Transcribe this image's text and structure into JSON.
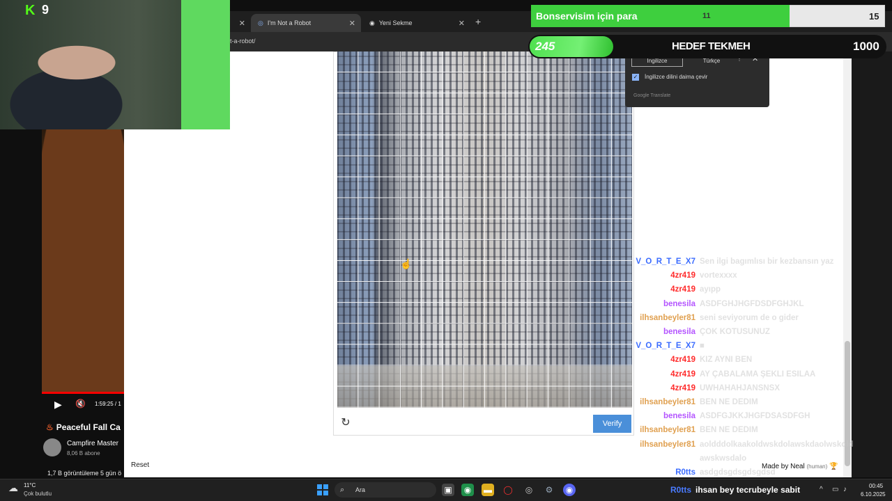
{
  "browser": {
    "tabs": [
      {
        "label": ""
      },
      {
        "label": "I'm Not a Robot"
      },
      {
        "label": "Yeni Sekme"
      }
    ],
    "new_tab": "+",
    "url": "t-a-robot/"
  },
  "translate": {
    "lang_from": "İngilizce",
    "lang_to": "Türkçe",
    "more": "⋮",
    "close": "✕",
    "always_label": "İngilizce dilini daima çevir",
    "brand": "Google Translate"
  },
  "captcha": {
    "verify_label": "Verify",
    "refresh": "↻"
  },
  "page": {
    "reset_label": "Reset"
  },
  "stream": {
    "kick_logo": "K",
    "kick_count": "9",
    "goal": {
      "label": "Bonservisim için para",
      "current": "11",
      "target": "15",
      "progress": 0.73
    },
    "hedef": {
      "count": "245",
      "label": "HEDEF TEKMEH",
      "target": "1000",
      "progress": 0.245
    },
    "made_by": "Made by Neal",
    "made_by_note": "(human)",
    "pinned_user": "R0tts",
    "pinned_msg": "ihsan bey tecrubeyle sabit"
  },
  "chat": [
    {
      "user": "V_O_R_T_E_X7",
      "color": "#3b6cff",
      "msg": "Sen ilgi bagımlısı bir kezbansın yaz"
    },
    {
      "user": "4zr419",
      "color": "#ff2a2a",
      "msg": "vortexxxx"
    },
    {
      "user": "4zr419",
      "color": "#ff2a2a",
      "msg": "ayıpp"
    },
    {
      "user": "benesila",
      "color": "#b455ff",
      "msg": "ASDFGHJHGFDSDFGHJKL"
    },
    {
      "user": "ilhsanbeyler81",
      "color": "#e0a050",
      "msg": "seni seviyorum de o gider"
    },
    {
      "user": "benesila",
      "color": "#b455ff",
      "msg": "ÇOK KÖTÜSÜNÜZ"
    },
    {
      "user": "V_O_R_T_E_X7",
      "color": "#3b6cff",
      "msg": "■"
    },
    {
      "user": "4zr419",
      "color": "#ff2a2a",
      "msg": "KIZ AYNI BEN"
    },
    {
      "user": "4zr419",
      "color": "#ff2a2a",
      "msg": "AY ÇABALAMA ŞEKLİ ESILAA"
    },
    {
      "user": "4zr419",
      "color": "#ff2a2a",
      "msg": "UWHAHAHJANSNSX"
    },
    {
      "user": "ilhsanbeyler81",
      "color": "#e0a050",
      "msg": "BEN NE DEDİM"
    },
    {
      "user": "benesila",
      "color": "#b455ff",
      "msg": "ASDFGJKKJHGFDSASDFGH"
    },
    {
      "user": "ilhsanbeyler81",
      "color": "#e0a050",
      "msg": "BEN NE DEDİM"
    },
    {
      "user": "ilhsanbeyler81",
      "color": "#e0a050",
      "msg": "aoldddolkaakoldwskdolawskdaolwskold"
    },
    {
      "user": "",
      "color": "#e0a050",
      "msg": "awskwsdalo"
    },
    {
      "user": "R0tts",
      "color": "#3b6cff",
      "msg": "asdgdsgdsgdsgdsd"
    }
  ],
  "video": {
    "time": "1:59:25 / 1",
    "title": "Peaceful Fall Ca",
    "channel": "Campfire Master",
    "subs": "8,06 B abone",
    "views": "1,7 B görüntüleme  5 gün ö"
  },
  "taskbar": {
    "temp": "11°C",
    "weather": "Çok bulutlu",
    "search_placeholder": "Ara",
    "time": "00:45",
    "date": "6.10.2025"
  }
}
